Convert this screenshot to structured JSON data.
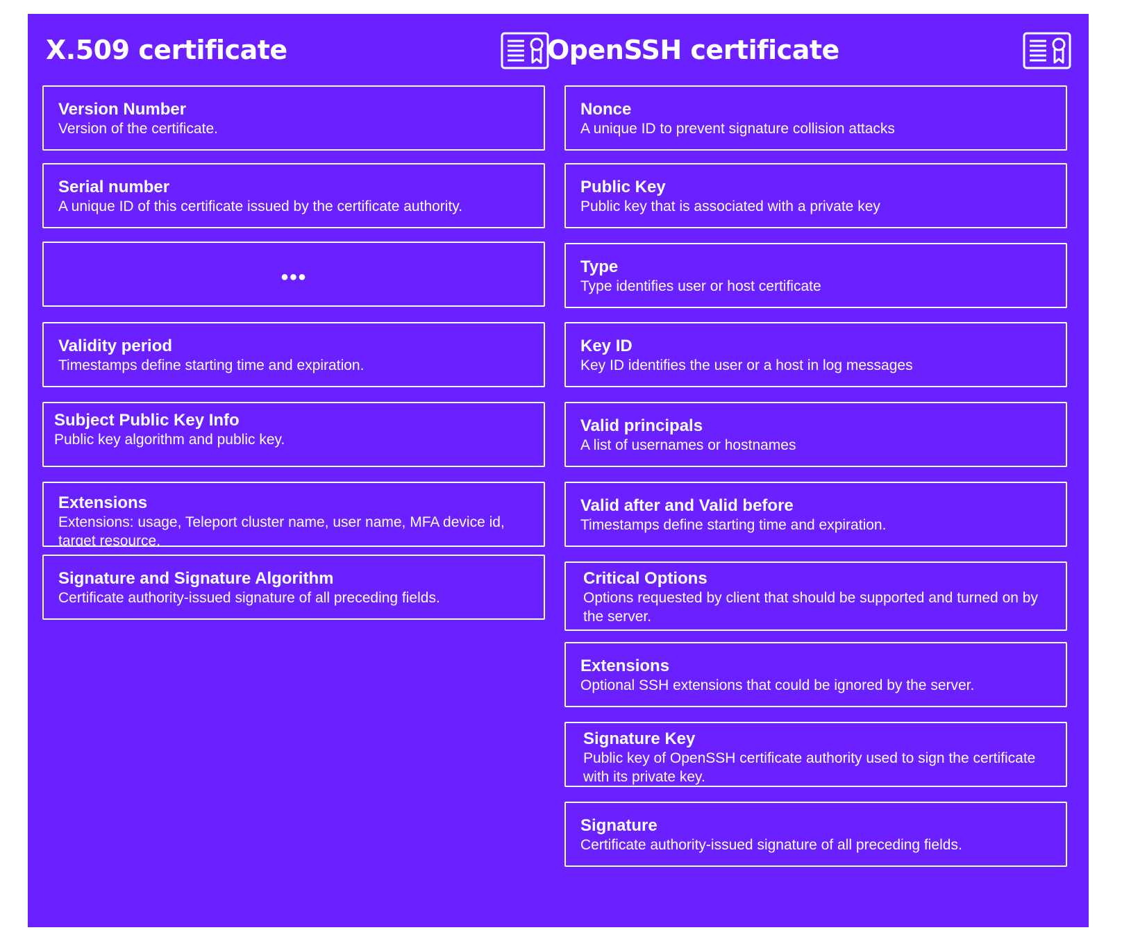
{
  "colors": {
    "background": "#6a20ff",
    "foreground": "#ffffff"
  },
  "x509": {
    "title": "X.509 certificate",
    "icon": "certificate-icon",
    "fields": [
      {
        "title": "Version Number",
        "desc": "Version of the certificate."
      },
      {
        "title": "Serial number",
        "desc": "A unique ID of this certificate issued by the certificate authority."
      },
      {
        "ellipsis": "•••"
      },
      {
        "title": "Validity period",
        "desc": "Timestamps define starting time and expiration."
      },
      {
        "title": "Subject Public Key Info",
        "desc": "Public key algorithm and public key."
      },
      {
        "title": "Extensions",
        "desc": "Extensions: usage, Teleport cluster name,  user name, MFA device id, target resource."
      },
      {
        "title": "Signature and Signature Algorithm",
        "desc": "Certificate authority-issued signature of all preceding fields."
      }
    ]
  },
  "openssh": {
    "title": "OpenSSH certificate",
    "icon": "certificate-icon",
    "fields": [
      {
        "title": "Nonce",
        "desc": "A unique ID to prevent signature collision attacks"
      },
      {
        "title": "Public Key",
        "desc": "Public key that is associated with a private key"
      },
      {
        "title": "Type",
        "desc": "Type identifies user or host certificate"
      },
      {
        "title": "Key ID",
        "desc": "Key ID identifies the user or a host in log messages"
      },
      {
        "title": "Valid principals",
        "desc": "A list of usernames or hostnames"
      },
      {
        "title": "Valid after and Valid before",
        "desc": "Timestamps define starting time and expiration."
      },
      {
        "title": "Critical Options",
        "desc": "Options requested by client that should be supported and turned on by the server."
      },
      {
        "title": "Extensions",
        "desc": "Optional SSH extensions that could be ignored by the server."
      },
      {
        "title": "Signature Key",
        "desc": "Public key of OpenSSH certificate authority used to sign the certificate with its private key."
      },
      {
        "title": "Signature",
        "desc": "Certificate authority-issued signature of all preceding fields."
      }
    ]
  }
}
